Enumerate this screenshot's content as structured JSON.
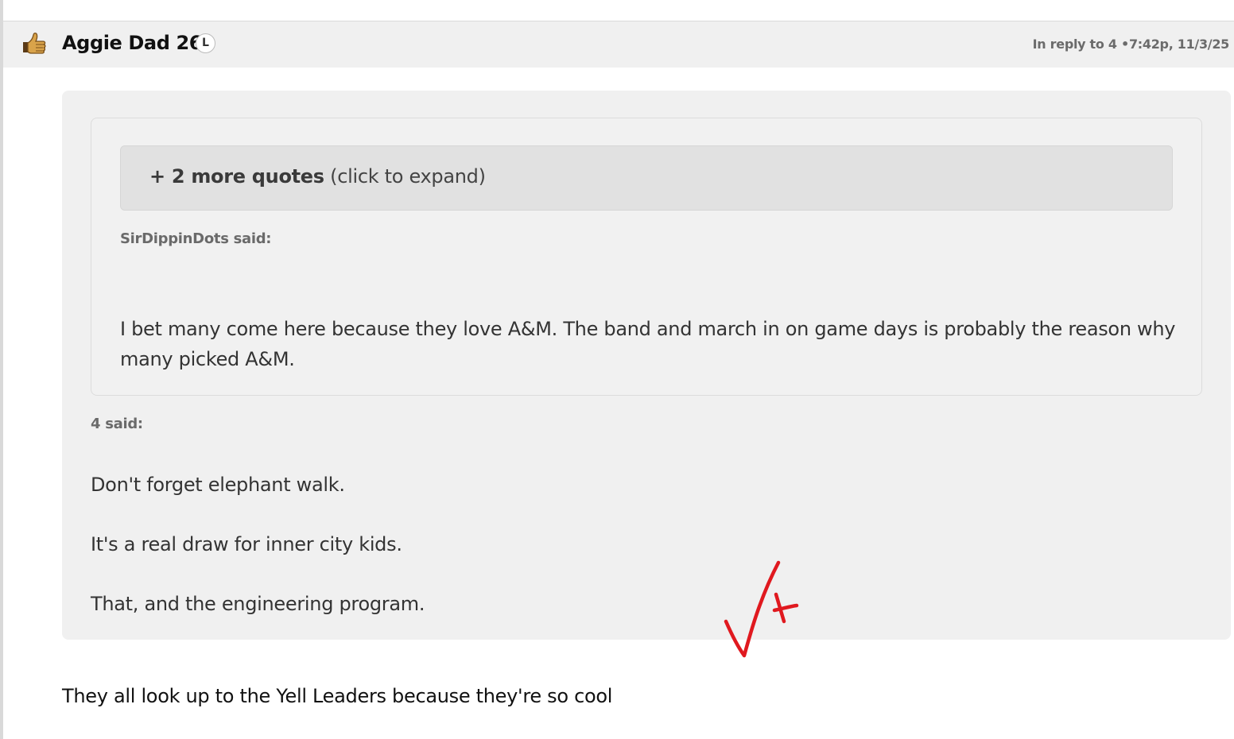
{
  "post": {
    "username": "Aggie Dad 26",
    "badge": "L",
    "reply_prefix": "In reply to",
    "reply_to": "4",
    "separator": "•",
    "timestamp": "7:42p, 11/3/25"
  },
  "quote_block": {
    "expand_bold": "+ 2 more quotes",
    "expand_hint": "(click to expand)",
    "inner": {
      "author_said": "SirDippinDots said:",
      "line1": "I bet many come here because they love A&M. The band and march in on game days is probably the reason why",
      "line2": "many picked A&M."
    },
    "outer": {
      "author_said": "4 said:",
      "paragraphs": [
        "Don't forget elephant walk.",
        "It's a real draw for inner city kids.",
        "That, and the engineering program."
      ]
    }
  },
  "reply_body": "They all look up to the Yell Leaders because they're so cool",
  "icons": {
    "avatar": "thumbs-up-hand-icon",
    "annotation": "red-checkmark-plus-annotation"
  },
  "colors": {
    "annotation": "#e0191f",
    "header_bg": "#f0f0f0",
    "quote_bg": "#f0f0f0",
    "expand_bg": "#e1e1e1"
  }
}
